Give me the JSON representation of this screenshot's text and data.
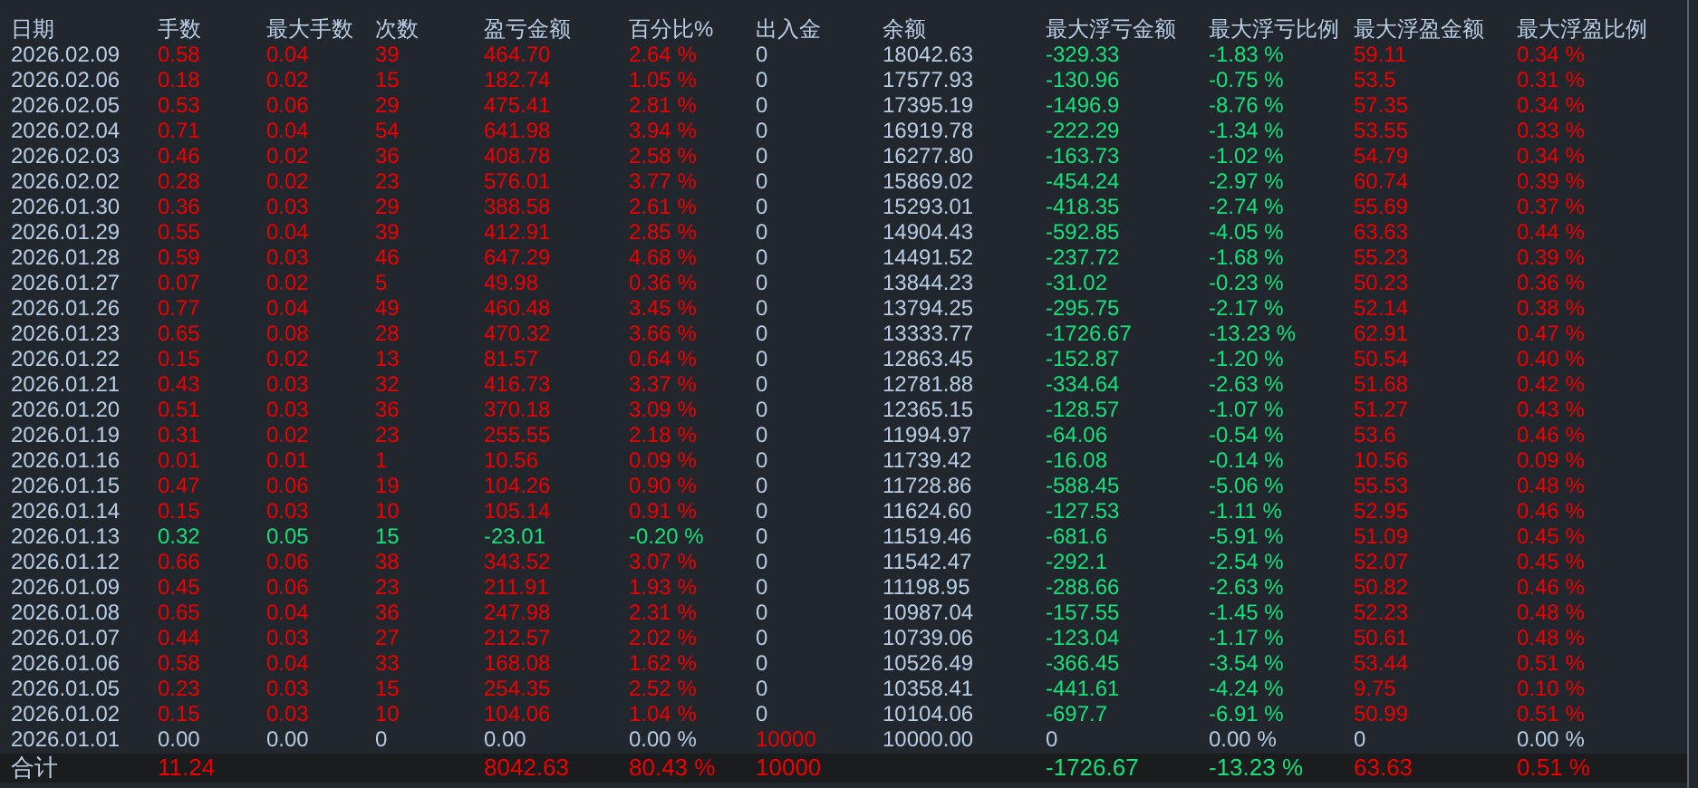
{
  "table": {
    "columns": [
      "日期",
      "手数",
      "最大手数",
      "次数",
      "盈亏金额",
      "百分比%",
      "出入金",
      "余额",
      "最大浮亏金额",
      "最大浮亏比例",
      "最大浮盈金额",
      "最大浮盈比例"
    ],
    "rows": [
      {
        "cells": [
          {
            "text": "2026.02.09",
            "color": "#b8cde6"
          },
          {
            "text": "0.58",
            "color": "#f00000"
          },
          {
            "text": "0.04",
            "color": "#f00000"
          },
          {
            "text": "39",
            "color": "#f00000"
          },
          {
            "text": "464.70",
            "color": "#f00000"
          },
          {
            "text": "2.64 %",
            "color": "#f00000"
          },
          {
            "text": "0",
            "color": "#b8cde6"
          },
          {
            "text": "18042.63",
            "color": "#b8cde6"
          },
          {
            "text": "-329.33",
            "color": "#17e27a"
          },
          {
            "text": "-1.83 %",
            "color": "#17e27a"
          },
          {
            "text": "59.11",
            "color": "#f00000"
          },
          {
            "text": "0.34 %",
            "color": "#f00000"
          }
        ]
      },
      {
        "cells": [
          {
            "text": "2026.02.06",
            "color": "#b8cde6"
          },
          {
            "text": "0.18",
            "color": "#f00000"
          },
          {
            "text": "0.02",
            "color": "#f00000"
          },
          {
            "text": "15",
            "color": "#f00000"
          },
          {
            "text": "182.74",
            "color": "#f00000"
          },
          {
            "text": "1.05 %",
            "color": "#f00000"
          },
          {
            "text": "0",
            "color": "#b8cde6"
          },
          {
            "text": "17577.93",
            "color": "#b8cde6"
          },
          {
            "text": "-130.96",
            "color": "#17e27a"
          },
          {
            "text": "-0.75 %",
            "color": "#17e27a"
          },
          {
            "text": "53.5",
            "color": "#f00000"
          },
          {
            "text": "0.31 %",
            "color": "#f00000"
          }
        ]
      },
      {
        "cells": [
          {
            "text": "2026.02.05",
            "color": "#b8cde6"
          },
          {
            "text": "0.53",
            "color": "#f00000"
          },
          {
            "text": "0.06",
            "color": "#f00000"
          },
          {
            "text": "29",
            "color": "#f00000"
          },
          {
            "text": "475.41",
            "color": "#f00000"
          },
          {
            "text": "2.81 %",
            "color": "#f00000"
          },
          {
            "text": "0",
            "color": "#b8cde6"
          },
          {
            "text": "17395.19",
            "color": "#b8cde6"
          },
          {
            "text": "-1496.9",
            "color": "#17e27a"
          },
          {
            "text": "-8.76 %",
            "color": "#17e27a"
          },
          {
            "text": "57.35",
            "color": "#f00000"
          },
          {
            "text": "0.34 %",
            "color": "#f00000"
          }
        ]
      },
      {
        "cells": [
          {
            "text": "2026.02.04",
            "color": "#b8cde6"
          },
          {
            "text": "0.71",
            "color": "#f00000"
          },
          {
            "text": "0.04",
            "color": "#f00000"
          },
          {
            "text": "54",
            "color": "#f00000"
          },
          {
            "text": "641.98",
            "color": "#f00000"
          },
          {
            "text": "3.94 %",
            "color": "#f00000"
          },
          {
            "text": "0",
            "color": "#b8cde6"
          },
          {
            "text": "16919.78",
            "color": "#b8cde6"
          },
          {
            "text": "-222.29",
            "color": "#17e27a"
          },
          {
            "text": "-1.34 %",
            "color": "#17e27a"
          },
          {
            "text": "53.55",
            "color": "#f00000"
          },
          {
            "text": "0.33 %",
            "color": "#f00000"
          }
        ]
      },
      {
        "cells": [
          {
            "text": "2026.02.03",
            "color": "#b8cde6"
          },
          {
            "text": "0.46",
            "color": "#f00000"
          },
          {
            "text": "0.02",
            "color": "#f00000"
          },
          {
            "text": "36",
            "color": "#f00000"
          },
          {
            "text": "408.78",
            "color": "#f00000"
          },
          {
            "text": "2.58 %",
            "color": "#f00000"
          },
          {
            "text": "0",
            "color": "#b8cde6"
          },
          {
            "text": "16277.80",
            "color": "#b8cde6"
          },
          {
            "text": "-163.73",
            "color": "#17e27a"
          },
          {
            "text": "-1.02 %",
            "color": "#17e27a"
          },
          {
            "text": "54.79",
            "color": "#f00000"
          },
          {
            "text": "0.34 %",
            "color": "#f00000"
          }
        ]
      },
      {
        "cells": [
          {
            "text": "2026.02.02",
            "color": "#b8cde6"
          },
          {
            "text": "0.28",
            "color": "#f00000"
          },
          {
            "text": "0.02",
            "color": "#f00000"
          },
          {
            "text": "23",
            "color": "#f00000"
          },
          {
            "text": "576.01",
            "color": "#f00000"
          },
          {
            "text": "3.77 %",
            "color": "#f00000"
          },
          {
            "text": "0",
            "color": "#b8cde6"
          },
          {
            "text": "15869.02",
            "color": "#b8cde6"
          },
          {
            "text": "-454.24",
            "color": "#17e27a"
          },
          {
            "text": "-2.97 %",
            "color": "#17e27a"
          },
          {
            "text": "60.74",
            "color": "#f00000"
          },
          {
            "text": "0.39 %",
            "color": "#f00000"
          }
        ]
      },
      {
        "cells": [
          {
            "text": "2026.01.30",
            "color": "#b8cde6"
          },
          {
            "text": "0.36",
            "color": "#f00000"
          },
          {
            "text": "0.03",
            "color": "#f00000"
          },
          {
            "text": "29",
            "color": "#f00000"
          },
          {
            "text": "388.58",
            "color": "#f00000"
          },
          {
            "text": "2.61 %",
            "color": "#f00000"
          },
          {
            "text": "0",
            "color": "#b8cde6"
          },
          {
            "text": "15293.01",
            "color": "#b8cde6"
          },
          {
            "text": "-418.35",
            "color": "#17e27a"
          },
          {
            "text": "-2.74 %",
            "color": "#17e27a"
          },
          {
            "text": "55.69",
            "color": "#f00000"
          },
          {
            "text": "0.37 %",
            "color": "#f00000"
          }
        ]
      },
      {
        "cells": [
          {
            "text": "2026.01.29",
            "color": "#b8cde6"
          },
          {
            "text": "0.55",
            "color": "#f00000"
          },
          {
            "text": "0.04",
            "color": "#f00000"
          },
          {
            "text": "39",
            "color": "#f00000"
          },
          {
            "text": "412.91",
            "color": "#f00000"
          },
          {
            "text": "2.85 %",
            "color": "#f00000"
          },
          {
            "text": "0",
            "color": "#b8cde6"
          },
          {
            "text": "14904.43",
            "color": "#b8cde6"
          },
          {
            "text": "-592.85",
            "color": "#17e27a"
          },
          {
            "text": "-4.05 %",
            "color": "#17e27a"
          },
          {
            "text": "63.63",
            "color": "#f00000"
          },
          {
            "text": "0.44 %",
            "color": "#f00000"
          }
        ]
      },
      {
        "cells": [
          {
            "text": "2026.01.28",
            "color": "#b8cde6"
          },
          {
            "text": "0.59",
            "color": "#f00000"
          },
          {
            "text": "0.03",
            "color": "#f00000"
          },
          {
            "text": "46",
            "color": "#f00000"
          },
          {
            "text": "647.29",
            "color": "#f00000"
          },
          {
            "text": "4.68 %",
            "color": "#f00000"
          },
          {
            "text": "0",
            "color": "#b8cde6"
          },
          {
            "text": "14491.52",
            "color": "#b8cde6"
          },
          {
            "text": "-237.72",
            "color": "#17e27a"
          },
          {
            "text": "-1.68 %",
            "color": "#17e27a"
          },
          {
            "text": "55.23",
            "color": "#f00000"
          },
          {
            "text": "0.39 %",
            "color": "#f00000"
          }
        ]
      },
      {
        "cells": [
          {
            "text": "2026.01.27",
            "color": "#b8cde6"
          },
          {
            "text": "0.07",
            "color": "#f00000"
          },
          {
            "text": "0.02",
            "color": "#f00000"
          },
          {
            "text": "5",
            "color": "#f00000"
          },
          {
            "text": "49.98",
            "color": "#f00000"
          },
          {
            "text": "0.36 %",
            "color": "#f00000"
          },
          {
            "text": "0",
            "color": "#b8cde6"
          },
          {
            "text": "13844.23",
            "color": "#b8cde6"
          },
          {
            "text": "-31.02",
            "color": "#17e27a"
          },
          {
            "text": "-0.23 %",
            "color": "#17e27a"
          },
          {
            "text": "50.23",
            "color": "#f00000"
          },
          {
            "text": "0.36 %",
            "color": "#f00000"
          }
        ]
      },
      {
        "cells": [
          {
            "text": "2026.01.26",
            "color": "#b8cde6"
          },
          {
            "text": "0.77",
            "color": "#f00000"
          },
          {
            "text": "0.04",
            "color": "#f00000"
          },
          {
            "text": "49",
            "color": "#f00000"
          },
          {
            "text": "460.48",
            "color": "#f00000"
          },
          {
            "text": "3.45 %",
            "color": "#f00000"
          },
          {
            "text": "0",
            "color": "#b8cde6"
          },
          {
            "text": "13794.25",
            "color": "#b8cde6"
          },
          {
            "text": "-295.75",
            "color": "#17e27a"
          },
          {
            "text": "-2.17 %",
            "color": "#17e27a"
          },
          {
            "text": "52.14",
            "color": "#f00000"
          },
          {
            "text": "0.38 %",
            "color": "#f00000"
          }
        ]
      },
      {
        "cells": [
          {
            "text": "2026.01.23",
            "color": "#b8cde6"
          },
          {
            "text": "0.65",
            "color": "#f00000"
          },
          {
            "text": "0.08",
            "color": "#f00000"
          },
          {
            "text": "28",
            "color": "#f00000"
          },
          {
            "text": "470.32",
            "color": "#f00000"
          },
          {
            "text": "3.66 %",
            "color": "#f00000"
          },
          {
            "text": "0",
            "color": "#b8cde6"
          },
          {
            "text": "13333.77",
            "color": "#b8cde6"
          },
          {
            "text": "-1726.67",
            "color": "#17e27a"
          },
          {
            "text": "-13.23 %",
            "color": "#17e27a"
          },
          {
            "text": "62.91",
            "color": "#f00000"
          },
          {
            "text": "0.47 %",
            "color": "#f00000"
          }
        ]
      },
      {
        "cells": [
          {
            "text": "2026.01.22",
            "color": "#b8cde6"
          },
          {
            "text": "0.15",
            "color": "#f00000"
          },
          {
            "text": "0.02",
            "color": "#f00000"
          },
          {
            "text": "13",
            "color": "#f00000"
          },
          {
            "text": "81.57",
            "color": "#f00000"
          },
          {
            "text": "0.64 %",
            "color": "#f00000"
          },
          {
            "text": "0",
            "color": "#b8cde6"
          },
          {
            "text": "12863.45",
            "color": "#b8cde6"
          },
          {
            "text": "-152.87",
            "color": "#17e27a"
          },
          {
            "text": "-1.20 %",
            "color": "#17e27a"
          },
          {
            "text": "50.54",
            "color": "#f00000"
          },
          {
            "text": "0.40 %",
            "color": "#f00000"
          }
        ]
      },
      {
        "cells": [
          {
            "text": "2026.01.21",
            "color": "#b8cde6"
          },
          {
            "text": "0.43",
            "color": "#f00000"
          },
          {
            "text": "0.03",
            "color": "#f00000"
          },
          {
            "text": "32",
            "color": "#f00000"
          },
          {
            "text": "416.73",
            "color": "#f00000"
          },
          {
            "text": "3.37 %",
            "color": "#f00000"
          },
          {
            "text": "0",
            "color": "#b8cde6"
          },
          {
            "text": "12781.88",
            "color": "#b8cde6"
          },
          {
            "text": "-334.64",
            "color": "#17e27a"
          },
          {
            "text": "-2.63 %",
            "color": "#17e27a"
          },
          {
            "text": "51.68",
            "color": "#f00000"
          },
          {
            "text": "0.42 %",
            "color": "#f00000"
          }
        ]
      },
      {
        "cells": [
          {
            "text": "2026.01.20",
            "color": "#b8cde6"
          },
          {
            "text": "0.51",
            "color": "#f00000"
          },
          {
            "text": "0.03",
            "color": "#f00000"
          },
          {
            "text": "36",
            "color": "#f00000"
          },
          {
            "text": "370.18",
            "color": "#f00000"
          },
          {
            "text": "3.09 %",
            "color": "#f00000"
          },
          {
            "text": "0",
            "color": "#b8cde6"
          },
          {
            "text": "12365.15",
            "color": "#b8cde6"
          },
          {
            "text": "-128.57",
            "color": "#17e27a"
          },
          {
            "text": "-1.07 %",
            "color": "#17e27a"
          },
          {
            "text": "51.27",
            "color": "#f00000"
          },
          {
            "text": "0.43 %",
            "color": "#f00000"
          }
        ]
      },
      {
        "cells": [
          {
            "text": "2026.01.19",
            "color": "#b8cde6"
          },
          {
            "text": "0.31",
            "color": "#f00000"
          },
          {
            "text": "0.02",
            "color": "#f00000"
          },
          {
            "text": "23",
            "color": "#f00000"
          },
          {
            "text": "255.55",
            "color": "#f00000"
          },
          {
            "text": "2.18 %",
            "color": "#f00000"
          },
          {
            "text": "0",
            "color": "#b8cde6"
          },
          {
            "text": "11994.97",
            "color": "#b8cde6"
          },
          {
            "text": "-64.06",
            "color": "#17e27a"
          },
          {
            "text": "-0.54 %",
            "color": "#17e27a"
          },
          {
            "text": "53.6",
            "color": "#f00000"
          },
          {
            "text": "0.46 %",
            "color": "#f00000"
          }
        ]
      },
      {
        "cells": [
          {
            "text": "2026.01.16",
            "color": "#b8cde6"
          },
          {
            "text": "0.01",
            "color": "#f00000"
          },
          {
            "text": "0.01",
            "color": "#f00000"
          },
          {
            "text": "1",
            "color": "#f00000"
          },
          {
            "text": "10.56",
            "color": "#f00000"
          },
          {
            "text": "0.09 %",
            "color": "#f00000"
          },
          {
            "text": "0",
            "color": "#b8cde6"
          },
          {
            "text": "11739.42",
            "color": "#b8cde6"
          },
          {
            "text": "-16.08",
            "color": "#17e27a"
          },
          {
            "text": "-0.14 %",
            "color": "#17e27a"
          },
          {
            "text": "10.56",
            "color": "#f00000"
          },
          {
            "text": "0.09 %",
            "color": "#f00000"
          }
        ]
      },
      {
        "cells": [
          {
            "text": "2026.01.15",
            "color": "#b8cde6"
          },
          {
            "text": "0.47",
            "color": "#f00000"
          },
          {
            "text": "0.06",
            "color": "#f00000"
          },
          {
            "text": "19",
            "color": "#f00000"
          },
          {
            "text": "104.26",
            "color": "#f00000"
          },
          {
            "text": "0.90 %",
            "color": "#f00000"
          },
          {
            "text": "0",
            "color": "#b8cde6"
          },
          {
            "text": "11728.86",
            "color": "#b8cde6"
          },
          {
            "text": "-588.45",
            "color": "#17e27a"
          },
          {
            "text": "-5.06 %",
            "color": "#17e27a"
          },
          {
            "text": "55.53",
            "color": "#f00000"
          },
          {
            "text": "0.48 %",
            "color": "#f00000"
          }
        ]
      },
      {
        "cells": [
          {
            "text": "2026.01.14",
            "color": "#b8cde6"
          },
          {
            "text": "0.15",
            "color": "#f00000"
          },
          {
            "text": "0.03",
            "color": "#f00000"
          },
          {
            "text": "10",
            "color": "#f00000"
          },
          {
            "text": "105.14",
            "color": "#f00000"
          },
          {
            "text": "0.91 %",
            "color": "#f00000"
          },
          {
            "text": "0",
            "color": "#b8cde6"
          },
          {
            "text": "11624.60",
            "color": "#b8cde6"
          },
          {
            "text": "-127.53",
            "color": "#17e27a"
          },
          {
            "text": "-1.11 %",
            "color": "#17e27a"
          },
          {
            "text": "52.95",
            "color": "#f00000"
          },
          {
            "text": "0.46 %",
            "color": "#f00000"
          }
        ]
      },
      {
        "cells": [
          {
            "text": "2026.01.13",
            "color": "#b8cde6"
          },
          {
            "text": "0.32",
            "color": "#17e27a"
          },
          {
            "text": "0.05",
            "color": "#17e27a"
          },
          {
            "text": "15",
            "color": "#17e27a"
          },
          {
            "text": "-23.01",
            "color": "#17e27a"
          },
          {
            "text": "-0.20 %",
            "color": "#17e27a"
          },
          {
            "text": "0",
            "color": "#b8cde6"
          },
          {
            "text": "11519.46",
            "color": "#b8cde6"
          },
          {
            "text": "-681.6",
            "color": "#17e27a"
          },
          {
            "text": "-5.91 %",
            "color": "#17e27a"
          },
          {
            "text": "51.09",
            "color": "#f00000"
          },
          {
            "text": "0.45 %",
            "color": "#f00000"
          }
        ]
      },
      {
        "cells": [
          {
            "text": "2026.01.12",
            "color": "#b8cde6"
          },
          {
            "text": "0.66",
            "color": "#f00000"
          },
          {
            "text": "0.06",
            "color": "#f00000"
          },
          {
            "text": "38",
            "color": "#f00000"
          },
          {
            "text": "343.52",
            "color": "#f00000"
          },
          {
            "text": "3.07 %",
            "color": "#f00000"
          },
          {
            "text": "0",
            "color": "#b8cde6"
          },
          {
            "text": "11542.47",
            "color": "#b8cde6"
          },
          {
            "text": "-292.1",
            "color": "#17e27a"
          },
          {
            "text": "-2.54 %",
            "color": "#17e27a"
          },
          {
            "text": "52.07",
            "color": "#f00000"
          },
          {
            "text": "0.45 %",
            "color": "#f00000"
          }
        ]
      },
      {
        "cells": [
          {
            "text": "2026.01.09",
            "color": "#b8cde6"
          },
          {
            "text": "0.45",
            "color": "#f00000"
          },
          {
            "text": "0.06",
            "color": "#f00000"
          },
          {
            "text": "23",
            "color": "#f00000"
          },
          {
            "text": "211.91",
            "color": "#f00000"
          },
          {
            "text": "1.93 %",
            "color": "#f00000"
          },
          {
            "text": "0",
            "color": "#b8cde6"
          },
          {
            "text": "11198.95",
            "color": "#b8cde6"
          },
          {
            "text": "-288.66",
            "color": "#17e27a"
          },
          {
            "text": "-2.63 %",
            "color": "#17e27a"
          },
          {
            "text": "50.82",
            "color": "#f00000"
          },
          {
            "text": "0.46 %",
            "color": "#f00000"
          }
        ]
      },
      {
        "cells": [
          {
            "text": "2026.01.08",
            "color": "#b8cde6"
          },
          {
            "text": "0.65",
            "color": "#f00000"
          },
          {
            "text": "0.04",
            "color": "#f00000"
          },
          {
            "text": "36",
            "color": "#f00000"
          },
          {
            "text": "247.98",
            "color": "#f00000"
          },
          {
            "text": "2.31 %",
            "color": "#f00000"
          },
          {
            "text": "0",
            "color": "#b8cde6"
          },
          {
            "text": "10987.04",
            "color": "#b8cde6"
          },
          {
            "text": "-157.55",
            "color": "#17e27a"
          },
          {
            "text": "-1.45 %",
            "color": "#17e27a"
          },
          {
            "text": "52.23",
            "color": "#f00000"
          },
          {
            "text": "0.48 %",
            "color": "#f00000"
          }
        ]
      },
      {
        "cells": [
          {
            "text": "2026.01.07",
            "color": "#b8cde6"
          },
          {
            "text": "0.44",
            "color": "#f00000"
          },
          {
            "text": "0.03",
            "color": "#f00000"
          },
          {
            "text": "27",
            "color": "#f00000"
          },
          {
            "text": "212.57",
            "color": "#f00000"
          },
          {
            "text": "2.02 %",
            "color": "#f00000"
          },
          {
            "text": "0",
            "color": "#b8cde6"
          },
          {
            "text": "10739.06",
            "color": "#b8cde6"
          },
          {
            "text": "-123.04",
            "color": "#17e27a"
          },
          {
            "text": "-1.17 %",
            "color": "#17e27a"
          },
          {
            "text": "50.61",
            "color": "#f00000"
          },
          {
            "text": "0.48 %",
            "color": "#f00000"
          }
        ]
      },
      {
        "cells": [
          {
            "text": "2026.01.06",
            "color": "#b8cde6"
          },
          {
            "text": "0.58",
            "color": "#f00000"
          },
          {
            "text": "0.04",
            "color": "#f00000"
          },
          {
            "text": "33",
            "color": "#f00000"
          },
          {
            "text": "168.08",
            "color": "#f00000"
          },
          {
            "text": "1.62 %",
            "color": "#f00000"
          },
          {
            "text": "0",
            "color": "#b8cde6"
          },
          {
            "text": "10526.49",
            "color": "#b8cde6"
          },
          {
            "text": "-366.45",
            "color": "#17e27a"
          },
          {
            "text": "-3.54 %",
            "color": "#17e27a"
          },
          {
            "text": "53.44",
            "color": "#f00000"
          },
          {
            "text": "0.51 %",
            "color": "#f00000"
          }
        ]
      },
      {
        "cells": [
          {
            "text": "2026.01.05",
            "color": "#b8cde6"
          },
          {
            "text": "0.23",
            "color": "#f00000"
          },
          {
            "text": "0.03",
            "color": "#f00000"
          },
          {
            "text": "15",
            "color": "#f00000"
          },
          {
            "text": "254.35",
            "color": "#f00000"
          },
          {
            "text": "2.52 %",
            "color": "#f00000"
          },
          {
            "text": "0",
            "color": "#b8cde6"
          },
          {
            "text": "10358.41",
            "color": "#b8cde6"
          },
          {
            "text": "-441.61",
            "color": "#17e27a"
          },
          {
            "text": "-4.24 %",
            "color": "#17e27a"
          },
          {
            "text": "9.75",
            "color": "#f00000"
          },
          {
            "text": "0.10 %",
            "color": "#f00000"
          }
        ]
      },
      {
        "cells": [
          {
            "text": "2026.01.02",
            "color": "#b8cde6"
          },
          {
            "text": "0.15",
            "color": "#f00000"
          },
          {
            "text": "0.03",
            "color": "#f00000"
          },
          {
            "text": "10",
            "color": "#f00000"
          },
          {
            "text": "104.06",
            "color": "#f00000"
          },
          {
            "text": "1.04 %",
            "color": "#f00000"
          },
          {
            "text": "0",
            "color": "#b8cde6"
          },
          {
            "text": "10104.06",
            "color": "#b8cde6"
          },
          {
            "text": "-697.7",
            "color": "#17e27a"
          },
          {
            "text": "-6.91 %",
            "color": "#17e27a"
          },
          {
            "text": "50.99",
            "color": "#f00000"
          },
          {
            "text": "0.51 %",
            "color": "#f00000"
          }
        ]
      },
      {
        "cells": [
          {
            "text": "2026.01.01",
            "color": "#b8cde6"
          },
          {
            "text": "0.00",
            "color": "#b8cde6"
          },
          {
            "text": "0.00",
            "color": "#b8cde6"
          },
          {
            "text": "0",
            "color": "#b8cde6"
          },
          {
            "text": "0.00",
            "color": "#b8cde6"
          },
          {
            "text": "0.00 %",
            "color": "#b8cde6"
          },
          {
            "text": "10000",
            "color": "#f00000"
          },
          {
            "text": "10000.00",
            "color": "#b8cde6"
          },
          {
            "text": "0",
            "color": "#b8cde6"
          },
          {
            "text": "0.00 %",
            "color": "#b8cde6"
          },
          {
            "text": "0",
            "color": "#b8cde6"
          },
          {
            "text": "0.00 %",
            "color": "#b8cde6"
          }
        ]
      }
    ],
    "total": {
      "cells": [
        {
          "text": "合计",
          "color": "#b8cde6"
        },
        {
          "text": "11.24",
          "color": "#f00000"
        },
        null,
        null,
        {
          "text": "8042.63",
          "color": "#f00000"
        },
        {
          "text": "80.43 %",
          "color": "#f00000"
        },
        {
          "text": "10000",
          "color": "#f00000"
        },
        null,
        {
          "text": "-1726.67",
          "color": "#17e27a"
        },
        {
          "text": "-13.23 %",
          "color": "#17e27a"
        },
        {
          "text": "63.63",
          "color": "#f00000"
        },
        {
          "text": "0.51 %",
          "color": "#f00000"
        }
      ]
    }
  }
}
